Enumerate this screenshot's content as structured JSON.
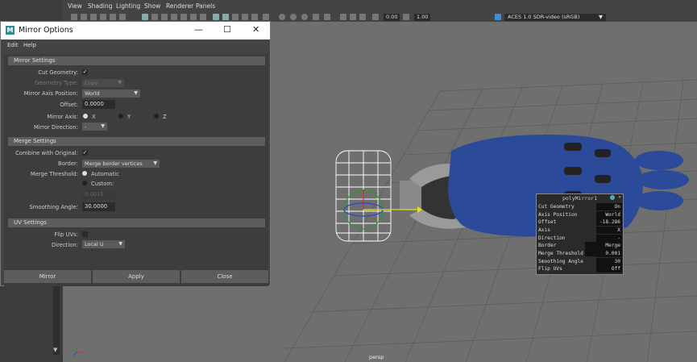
{
  "menubar": {
    "items": [
      "View",
      "Shading",
      "Lighting",
      "Show",
      "Renderer",
      "Panels"
    ]
  },
  "toolbar": {
    "value1": "0.00",
    "value2": "1.00",
    "color_space": "ACES 1.0 SDR-video (sRGB)"
  },
  "dialog": {
    "title": "Mirror Options",
    "menu": [
      "Edit",
      "Help"
    ],
    "mirror_settings": {
      "header": "Mirror Settings",
      "cut_geometry_label": "Cut Geometry:",
      "geometry_type_label": "Geometry Type:",
      "geometry_type_value": "Copy",
      "axis_position_label": "Mirror Axis Position:",
      "axis_position_value": "World",
      "offset_label": "Offset:",
      "offset_value": "0.0000",
      "mirror_axis_label": "Mirror Axis:",
      "axis_x": "X",
      "axis_y": "Y",
      "axis_z": "Z",
      "direction_label": "Mirror Direction:",
      "direction_value": "-"
    },
    "merge_settings": {
      "header": "Merge Settings",
      "combine_label": "Combine with Original:",
      "border_label": "Border:",
      "border_value": "Merge border vertices",
      "threshold_label": "Merge Threshold:",
      "automatic_label": "Automatic",
      "custom_label": "Custom:",
      "custom_value": "0.0010",
      "smoothing_label": "Smoothing Angle:",
      "smoothing_value": "30.0000"
    },
    "uv_settings": {
      "header": "UV Settings",
      "flip_label": "Flip UVs:",
      "direction_label": "Direction:",
      "direction_value": "Local U"
    },
    "buttons": {
      "mirror": "Mirror",
      "apply": "Apply",
      "close": "Close"
    }
  },
  "hud": {
    "title": "polyMirror1",
    "rows": [
      {
        "k": "Cut Geometry",
        "v": "On"
      },
      {
        "k": "Axis Position",
        "v": "World"
      },
      {
        "k": "Offset",
        "v": "-18.286"
      },
      {
        "k": "Axis",
        "v": "X"
      },
      {
        "k": "Direction",
        "v": "-"
      },
      {
        "k": "Border",
        "v": "Merge border"
      },
      {
        "k": "Merge Threshold",
        "v": "0.001"
      },
      {
        "k": "Smoothing Angle",
        "v": "30"
      },
      {
        "k": "Flip UVs",
        "v": "Off"
      }
    ]
  },
  "viewport": {
    "camera_label": "persp"
  }
}
